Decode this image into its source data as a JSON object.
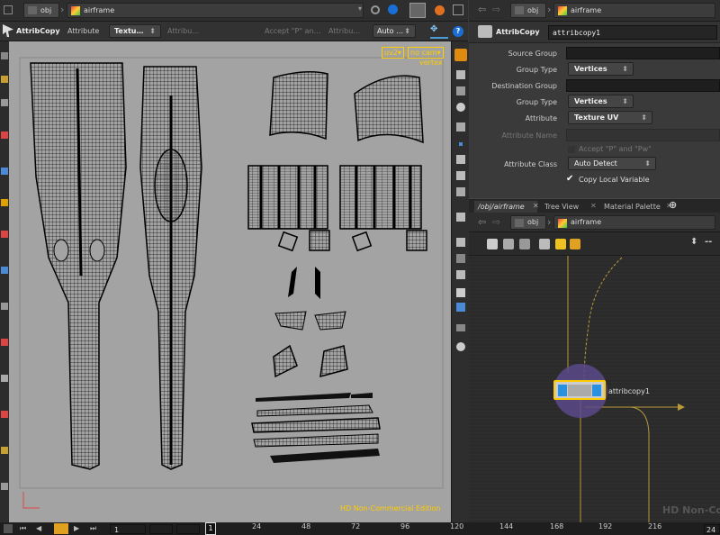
{
  "left_header": {
    "path_obj": "obj",
    "path_node": "airframe"
  },
  "right_header": {
    "path_obj": "obj",
    "path_node": "airframe"
  },
  "op_toolbar": {
    "op_label": "AttribCopy",
    "attribute_label": "Attribute",
    "attribute_value": "Textu…",
    "attribute_field": "Attribu…",
    "accept_label": "Accept \"P\" an…",
    "attribute_field2": "Attribu…",
    "auto_value": "Auto …"
  },
  "viewport": {
    "uv_menu": "uv2",
    "cam_menu": "no cam",
    "vertex_label": "vertex",
    "watermark": "HD Non-Commercial Edition"
  },
  "params": {
    "node_type": "AttribCopy",
    "node_name": "attribcopy1",
    "source_group_label": "Source Group",
    "group_type_label": "Group Type",
    "group_type_value": "Vertices",
    "dest_group_label": "Destination Group",
    "group_type2_label": "Group Type",
    "group_type2_value": "Vertices",
    "attribute_label": "Attribute",
    "attribute_value": "Texture UV",
    "attr_name_label": "Attribute Name",
    "accept_label": "Accept \"P\" and \"Pw\"",
    "attr_class_label": "Attribute Class",
    "attr_class_value": "Auto Detect",
    "copy_local_label": "Copy Local Variable"
  },
  "tabs": [
    {
      "label": "/obj/airframe"
    },
    {
      "label": "Tree View"
    },
    {
      "label": "Material Palette"
    }
  ],
  "network": {
    "node_label": "attribcopy1",
    "watermark": "HD Non-Co"
  },
  "timeline": {
    "current_frame": "1",
    "ticks": [
      "24",
      "48",
      "72",
      "96",
      "120",
      "144",
      "168",
      "192",
      "216"
    ],
    "frame_field": "1",
    "end_field": "24"
  },
  "colors": {
    "accent_yellow": "#ffcc00",
    "node_purple": "#5a4a8a",
    "wire": "#b89a3a"
  }
}
